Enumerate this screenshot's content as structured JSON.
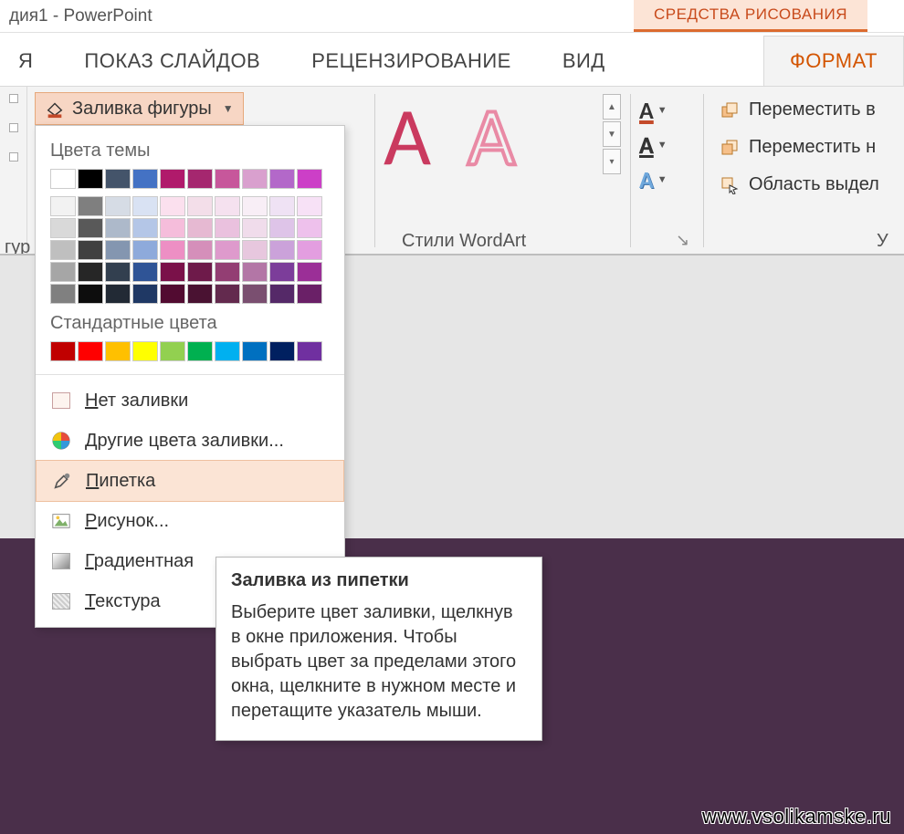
{
  "title_bar": {
    "doc_title": "дия1 - PowerPoint",
    "contextual_tab": "СРЕДСТВА РИСОВАНИЯ"
  },
  "tabs": {
    "cut_left": "Я",
    "slideshow": "ПОКАЗ СЛАЙДОВ",
    "review": "РЕЦЕНЗИРОВАНИЕ",
    "view": "ВИД",
    "format": "ФОРМАТ"
  },
  "ribbon": {
    "shape_fill_label": "Заливка фигуры",
    "left_group_caption": "гур",
    "wordart_caption": "Стили WordArt",
    "arrange": {
      "bring_forward": "Переместить в",
      "send_backward": "Переместить н",
      "selection_pane": "Область выдел"
    },
    "arrange_caption_cut": "У"
  },
  "dropdown": {
    "theme_label": "Цвета темы",
    "standard_label": "Стандартные цвета",
    "theme_colors_row1": [
      "#ffffff",
      "#000000",
      "#44546a",
      "#4472c4",
      "#b01a6b",
      "#a5276f",
      "#c7579b",
      "#d9a0ce",
      "#b368c9",
      "#cc3fc7"
    ],
    "theme_shade_rows": [
      [
        "#f2f2f2",
        "#7f7f7f",
        "#d6dce5",
        "#d9e2f3",
        "#fbe0ee",
        "#f3dee9",
        "#f5e1ef",
        "#f8eef6",
        "#efe2f4",
        "#f7e1f6"
      ],
      [
        "#d9d9d9",
        "#595959",
        "#adb9ca",
        "#b4c6e7",
        "#f5bddb",
        "#e6b9d2",
        "#eac1de",
        "#f0dceb",
        "#dec4e8",
        "#eec1ec"
      ],
      [
        "#bfbfbf",
        "#404040",
        "#8496b0",
        "#8eaadb",
        "#ed8fc4",
        "#d58fba",
        "#de9acc",
        "#e7c7de",
        "#cba2da",
        "#e39ee0"
      ],
      [
        "#a6a6a6",
        "#262626",
        "#323f4f",
        "#2f5496",
        "#7a1149",
        "#6e1a4a",
        "#933e73",
        "#b376a6",
        "#7c3d9a",
        "#9b2f97"
      ],
      [
        "#808080",
        "#0d0d0d",
        "#222a35",
        "#1f3864",
        "#520b31",
        "#4a1232",
        "#632a4e",
        "#7a4f70",
        "#552968",
        "#6a2067"
      ]
    ],
    "standard_colors": [
      "#c00000",
      "#ff0000",
      "#ffc000",
      "#ffff00",
      "#92d050",
      "#00b050",
      "#00b0f0",
      "#0070c0",
      "#002060",
      "#7030a0"
    ],
    "no_fill": "Нет заливки",
    "more_colors": "Другие цвета заливки...",
    "eyedropper": "Пипетка",
    "picture": "Рисунок...",
    "gradient": "Градиентная",
    "texture": "Текстура"
  },
  "tooltip": {
    "title": "Заливка из пипетки",
    "body": "Выберите цвет заливки, щелкнув в окне приложения. Чтобы выбрать цвет за пределами этого окна, щелкните в нужном месте и перетащите указатель мыши."
  },
  "watermark": "www.vsolikamske.ru"
}
